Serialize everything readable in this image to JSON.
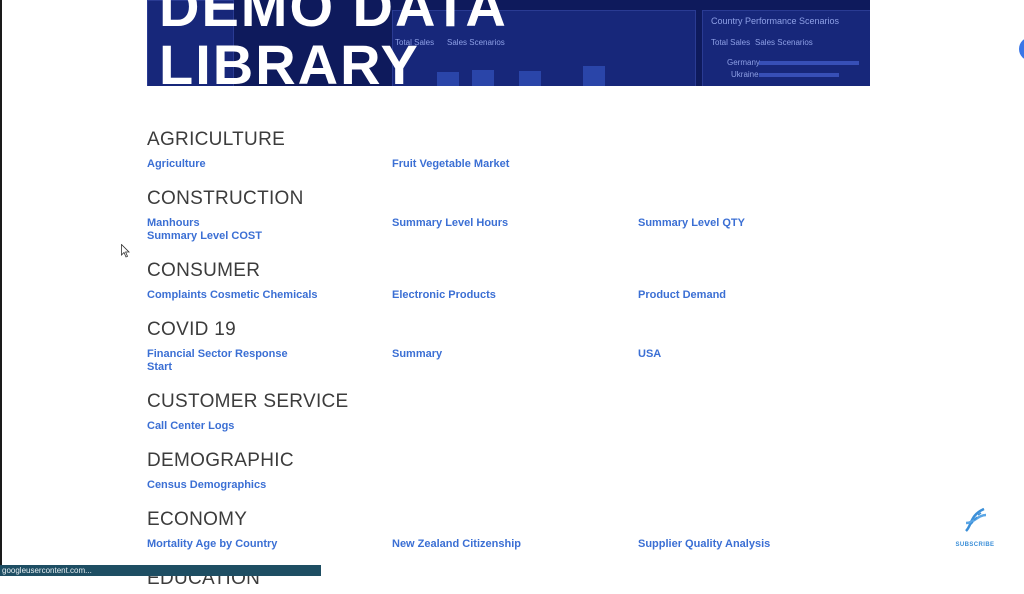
{
  "banner": {
    "title_line1": "DEMO DATA",
    "title_line2": "LIBRARY",
    "bg_panel_title": "Country Performance Scenarios",
    "bg_legend_1": "Total Sales",
    "bg_legend_2": "Sales Scenarios",
    "bg_row_1": "Germany",
    "bg_row_2": "Ukraine"
  },
  "categories": [
    {
      "title": "AGRICULTURE",
      "links": [
        "Agriculture",
        "Fruit Vegetable Market"
      ]
    },
    {
      "title": "CONSTRUCTION",
      "links": [
        "Manhours",
        "Summary Level Hours",
        "Summary Level QTY",
        "Summary Level COST"
      ]
    },
    {
      "title": "CONSUMER",
      "links": [
        "Complaints Cosmetic Chemicals",
        "Electronic Products",
        "Product Demand"
      ]
    },
    {
      "title": "COVID 19",
      "links": [
        "Financial Sector Response",
        "Summary",
        "USA",
        "Start"
      ]
    },
    {
      "title": "CUSTOMER SERVICE",
      "links": [
        "Call Center Logs"
      ]
    },
    {
      "title": "DEMOGRAPHIC",
      "links": [
        "Census Demographics"
      ]
    },
    {
      "title": "ECONOMY",
      "links": [
        "Mortality Age by Country",
        "New Zealand Citizenship",
        "Supplier Quality Analysis"
      ]
    },
    {
      "title": "EDUCATION",
      "links": []
    }
  ],
  "status_bar": {
    "text": "googleusercontent.com..."
  },
  "subscribe": {
    "label": "SUBSCRIBE",
    "icon": "dna-icon"
  },
  "colors": {
    "link": "#3b6fd4",
    "banner_bg": "#0e1a5c",
    "heading": "#3c3c3c"
  }
}
